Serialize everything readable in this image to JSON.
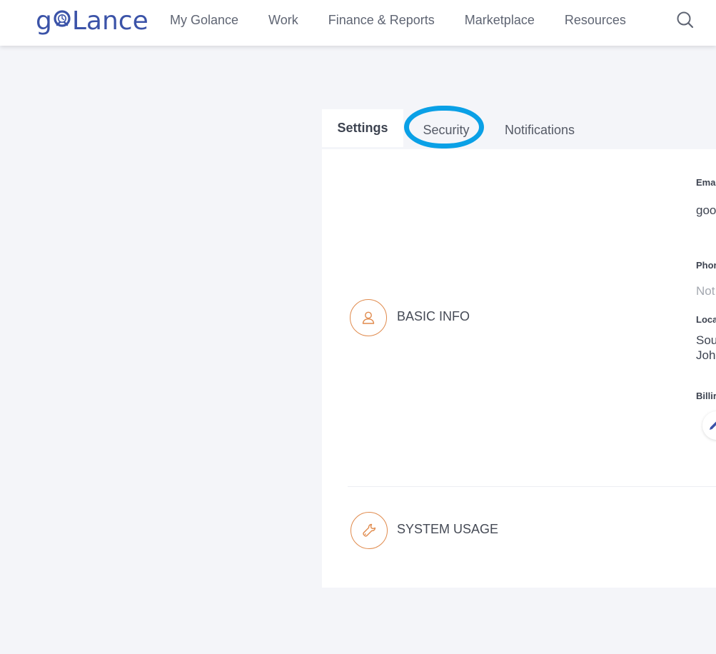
{
  "header": {
    "logo_left": "g",
    "logo_right": "Lance",
    "nav": [
      "My Golance",
      "Work",
      "Finance & Reports",
      "Marketplace",
      "Resources"
    ]
  },
  "tabs": [
    {
      "label": "Settings",
      "active": true
    },
    {
      "label": "Security",
      "active": false,
      "highlighted": true
    },
    {
      "label": "Notifications",
      "active": false
    }
  ],
  "sections": {
    "basic_info": {
      "title": "BASIC INFO"
    },
    "system_usage": {
      "title": "SYSTEM USAGE"
    }
  },
  "fields": {
    "email": {
      "label": "Ema",
      "value": "goo"
    },
    "phone": {
      "label": "Phor",
      "value": "Not"
    },
    "location": {
      "label": "Loca",
      "value_line1": "Sou",
      "value_line2": "Joh"
    },
    "billing": {
      "label": "Billir"
    }
  },
  "colors": {
    "brand": "#3b53a8",
    "accent_orange": "#e08a4c",
    "highlight_ring": "#0aa0e6",
    "background": "#f4f5f9"
  },
  "icons": {
    "search": "search-icon",
    "basic_info": "user-icon",
    "system_usage": "wrench-icon",
    "edit": "pencil-icon"
  }
}
